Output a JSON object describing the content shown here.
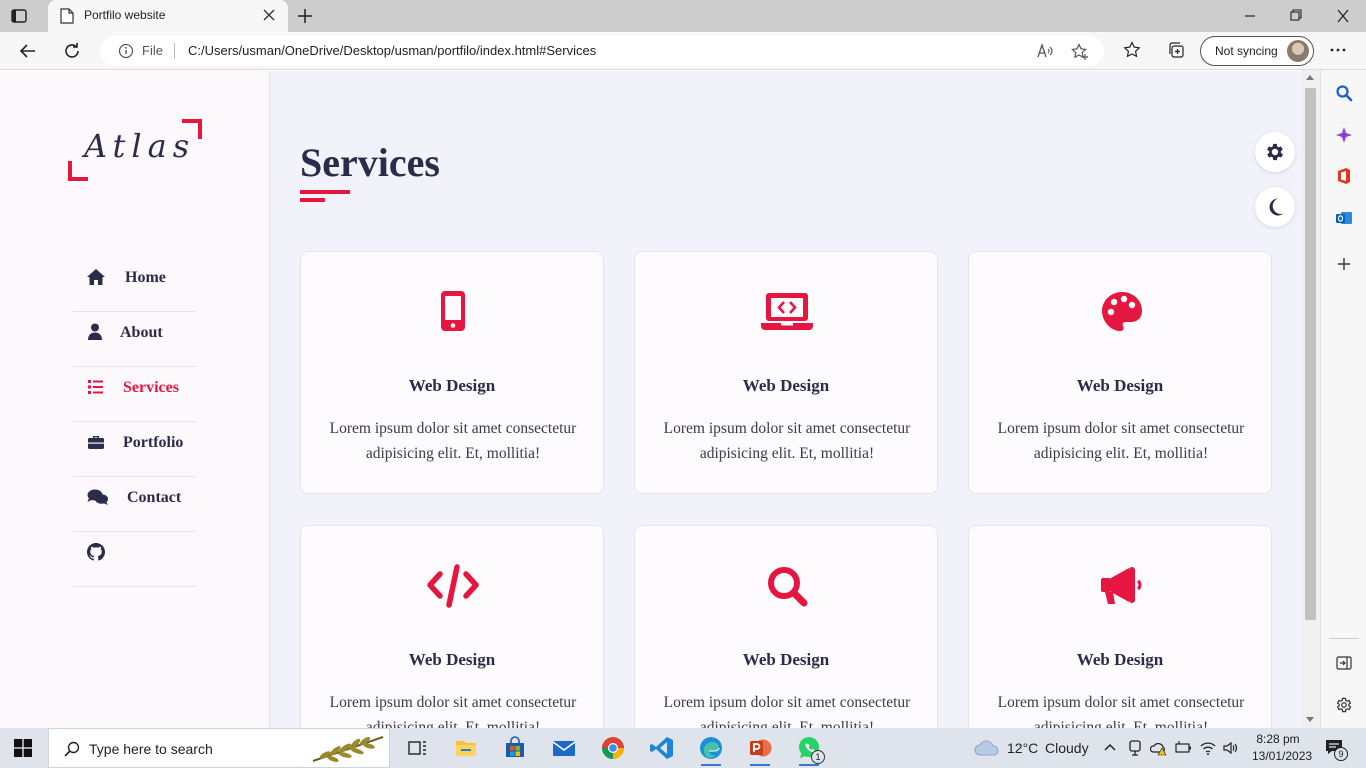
{
  "browser": {
    "tab_title": "Portfilo website",
    "url_scheme_label": "File",
    "url": "C:/Users/usman/OneDrive/Desktop/usman/portfilo/index.html#Services",
    "sync_label": "Not syncing"
  },
  "sidebar": {
    "logo_text": "Atlas",
    "items": [
      {
        "label": "Home",
        "icon": "home-icon",
        "active": false
      },
      {
        "label": "About",
        "icon": "user-icon",
        "active": false
      },
      {
        "label": "Services",
        "icon": "list-icon",
        "active": true
      },
      {
        "label": "Portfolio",
        "icon": "briefcase-icon",
        "active": false
      },
      {
        "label": "Contact",
        "icon": "comments-icon",
        "active": false
      },
      {
        "label": "",
        "icon": "github-icon",
        "active": false
      }
    ]
  },
  "main": {
    "heading": "Services",
    "cards": [
      {
        "icon": "mobile-icon",
        "title": "Web Design",
        "desc": "Lorem ipsum dolor sit amet consectetur adipisicing elit. Et, mollitia!"
      },
      {
        "icon": "laptop-code-icon",
        "title": "Web Design",
        "desc": "Lorem ipsum dolor sit amet consectetur adipisicing elit. Et, mollitia!"
      },
      {
        "icon": "palette-icon",
        "title": "Web Design",
        "desc": "Lorem ipsum dolor sit amet consectetur adipisicing elit. Et, mollitia!"
      },
      {
        "icon": "code-icon",
        "title": "Web Design",
        "desc": "Lorem ipsum dolor sit amet consectetur adipisicing elit. Et, mollitia!"
      },
      {
        "icon": "search-icon",
        "title": "Web Design",
        "desc": "Lorem ipsum dolor sit amet consectetur adipisicing elit. Et, mollitia!"
      },
      {
        "icon": "megaphone-icon",
        "title": "Web Design",
        "desc": "Lorem ipsum dolor sit amet consectetur adipisicing elit. Et, mollitia!"
      }
    ]
  },
  "colors": {
    "accent": "#e5163f",
    "text_dark": "#2b2c4a",
    "page_bg": "#f2f2fb"
  },
  "taskbar": {
    "search_placeholder": "Type here to search",
    "weather_temp": "12°C",
    "weather_desc": "Cloudy",
    "time": "8:28 pm",
    "date": "13/01/2023",
    "notification_count": "9",
    "whatsapp_badge": "1"
  }
}
